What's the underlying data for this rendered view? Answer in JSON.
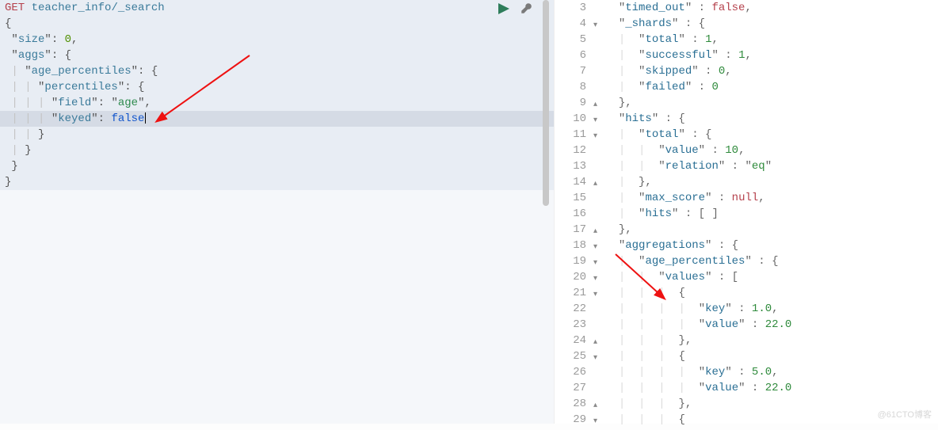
{
  "request": {
    "method": "GET",
    "path": "teacher_info/_search",
    "body_tokens": {
      "size_key": "size",
      "size_val": "0",
      "aggs_key": "aggs",
      "ap_key": "age_percentiles",
      "perc_key": "percentiles",
      "field_key": "field",
      "field_val": "age",
      "keyed_key": "keyed",
      "keyed_val": "false"
    }
  },
  "controls": {
    "run": "run-query",
    "settings": "query-settings"
  },
  "response_gutter": [
    "3",
    "4",
    "5",
    "6",
    "7",
    "8",
    "9",
    "10",
    "11",
    "12",
    "13",
    "14",
    "15",
    "16",
    "17",
    "18",
    "19",
    "20",
    "21",
    "22",
    "23",
    "24",
    "25",
    "26",
    "27",
    "28",
    "29"
  ],
  "response_fold": [
    "",
    "▾",
    "",
    "",
    "",
    "",
    "▴",
    "▾",
    "▾",
    "",
    "",
    "▴",
    "",
    "",
    "▴",
    "▾",
    "▾",
    "▾",
    "▾",
    "",
    "",
    "▴",
    "▾",
    "",
    "",
    "▴",
    "▾"
  ],
  "response": {
    "l3": {
      "k": "timed_out",
      "v": "false"
    },
    "l4": {
      "k": "_shards"
    },
    "l5": {
      "k": "total",
      "v": "1"
    },
    "l6": {
      "k": "successful",
      "v": "1"
    },
    "l7": {
      "k": "skipped",
      "v": "0"
    },
    "l8": {
      "k": "failed",
      "v": "0"
    },
    "l10": {
      "k": "hits"
    },
    "l11": {
      "k": "total"
    },
    "l12": {
      "k": "value",
      "v": "10"
    },
    "l13": {
      "k": "relation",
      "v": "eq"
    },
    "l15": {
      "k": "max_score",
      "v": "null"
    },
    "l16": {
      "k": "hits"
    },
    "l18": {
      "k": "aggregations"
    },
    "l19": {
      "k": "age_percentiles"
    },
    "l20": {
      "k": "values"
    },
    "l22": {
      "k": "key",
      "v": "1.0"
    },
    "l23": {
      "k": "value",
      "v": "22.0"
    },
    "l26": {
      "k": "key",
      "v": "5.0"
    },
    "l27": {
      "k": "value",
      "v": "22.0"
    }
  },
  "watermark": "@61CTO博客"
}
